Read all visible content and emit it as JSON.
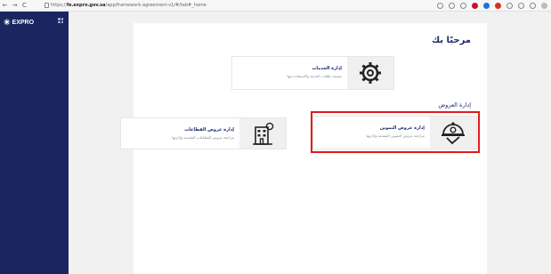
{
  "browser": {
    "url_prefix": "https://",
    "url_domain": "fe.expro.gov.sa",
    "url_path": "/app/framework-agreement-v1/#/tab#_home",
    "nav": [
      "←",
      "→",
      "C"
    ]
  },
  "sidebar": {
    "logo_text": "EXPRO",
    "logo_star": "✳"
  },
  "main": {
    "welcome": "مرحبًا بك",
    "section_title": "إدارة العروض",
    "tiles": {
      "services": {
        "title": "إدارة الخدمات",
        "subtitle": "تصنيف طلبات الخدمة والاستفادة منها"
      },
      "supply": {
        "title": "إدارة عروض التموين",
        "subtitle": "مراجعة عروض التموين المقدمة وإدارتها"
      },
      "sectors": {
        "title": "إدارة عروض القطاعات",
        "subtitle": "مراجعة عروض القطاعات المقدمة وإدارتها"
      }
    }
  },
  "colors": {
    "sidebar": "#1b255f",
    "accent": "#1b2a6b",
    "highlight": "#e21a1a"
  }
}
